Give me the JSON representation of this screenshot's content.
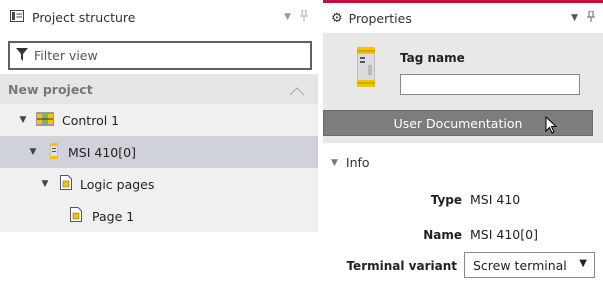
{
  "left_panel": {
    "title": "Project structure",
    "filter_placeholder": "Filter view",
    "project_name": "New project",
    "tree": [
      {
        "label": "Control 1",
        "expanded": true
      },
      {
        "label": "MSI 410[0]",
        "expanded": true,
        "selected": true
      },
      {
        "label": "Logic pages",
        "expanded": true
      },
      {
        "label": "Page 1"
      }
    ]
  },
  "right_panel": {
    "title": "Properties",
    "tag_name_label": "Tag name",
    "tag_name_value": "",
    "user_doc_button": "User Documentation",
    "info_section": "Info",
    "type_label": "Type",
    "type_value": "MSI 410",
    "name_label": "Name",
    "name_value": "MSI 410[0]",
    "terminal_label": "Terminal variant",
    "terminal_value": "Screw terminal"
  },
  "colors": {
    "accent_red": "#c4103a",
    "selected_row": "#cfd3d9",
    "button_gray": "#7d7d7d"
  }
}
